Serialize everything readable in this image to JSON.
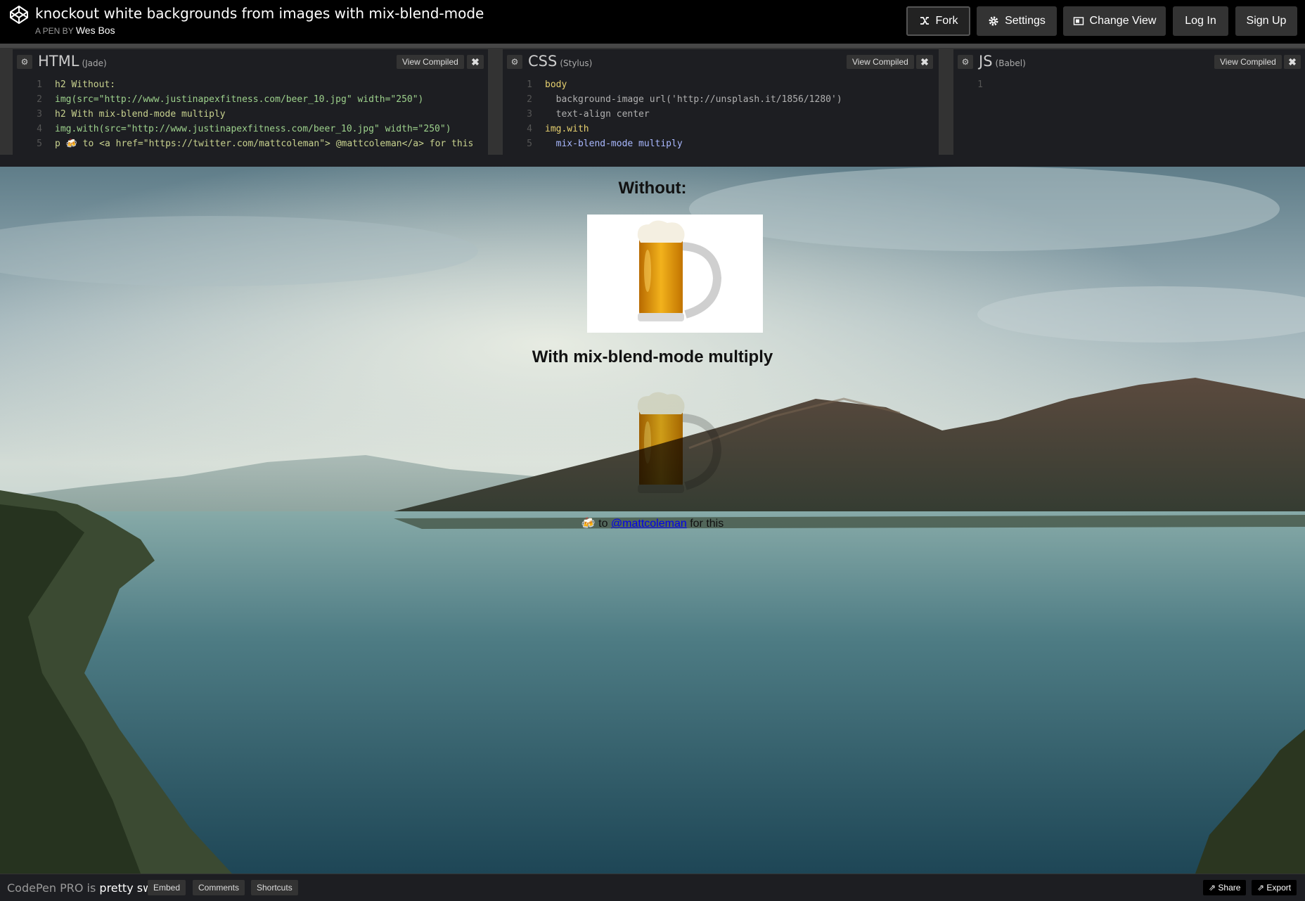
{
  "header": {
    "title": "knockout white backgrounds from images with mix-blend-mode",
    "byline_prefix": "A PEN BY",
    "author": "Wes Bos",
    "buttons": {
      "fork": "Fork",
      "settings": "Settings",
      "change_view": "Change View",
      "log_in": "Log In",
      "sign_up": "Sign Up"
    }
  },
  "editors": {
    "view_compiled_label": "View Compiled",
    "html": {
      "name": "HTML",
      "preprocessor": "(Jade)",
      "lines": [
        "h2 Without:",
        "img(src=\"http://www.justinapexfitness.com/beer_10.jpg\" width=\"250\")",
        "h2 With mix-blend-mode multiply",
        "img.with(src=\"http://www.justinapexfitness.com/beer_10.jpg\" width=\"250\")",
        "p 🍻 to <a href=\"https://twitter.com/mattcoleman\"> @mattcoleman</a> for this"
      ]
    },
    "css": {
      "name": "CSS",
      "preprocessor": "(Stylus)",
      "lines": [
        "body",
        "  background-image url('http://unsplash.it/1856/1280')",
        "  text-align center",
        "img.with",
        "  mix-blend-mode multiply"
      ]
    },
    "js": {
      "name": "JS",
      "preprocessor": "(Babel)",
      "lines": [
        ""
      ]
    }
  },
  "preview": {
    "heading_without": "Without:",
    "heading_with": "With mix-blend-mode multiply",
    "thanks_prefix": "🍻 to ",
    "thanks_link": "@mattcoleman",
    "thanks_suffix": " for this"
  },
  "footer": {
    "promo_prefix": "CodePen PRO is ",
    "promo_bold": "pretty sweet.",
    "buttons": {
      "embed": "Embed",
      "comments": "Comments",
      "shortcuts": "Shortcuts",
      "share": "Share",
      "export": "Export"
    }
  },
  "colors": {
    "header_bg": "#000000",
    "editor_bg": "#1d1e22",
    "button_bg": "#333333",
    "link": "#0000ee"
  }
}
